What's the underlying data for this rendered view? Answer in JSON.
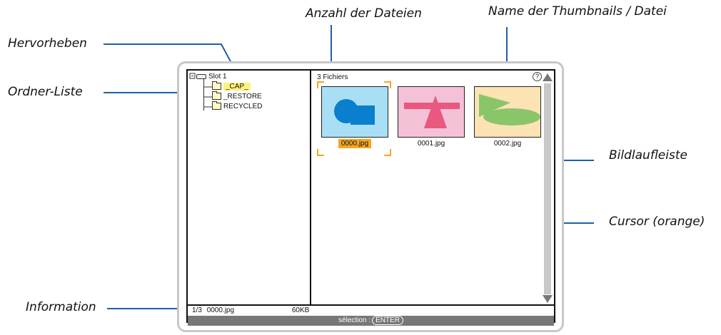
{
  "callouts": {
    "hervorheben": "Hervorheben",
    "ordner_liste": "Ordner-Liste",
    "anzahl": "Anzahl der Dateien",
    "name": "Name der Thumbnails / Datei",
    "bildlauf": "Bildlaufleiste",
    "cursor": "Cursor (orange)",
    "information": "Information"
  },
  "tree": {
    "root": "Slot 1",
    "folders": [
      "_CAP_",
      "_RESTORE",
      "RECYCLED"
    ],
    "highlight_color": "#fff27a"
  },
  "main": {
    "file_count": "3 Fichiers",
    "help_icon": "?",
    "thumbnails": [
      {
        "name": "0000.jpg",
        "bg": "#a9dff5",
        "selected": true
      },
      {
        "name": "0001.jpg",
        "bg": "#f5c1d6",
        "selected": false
      },
      {
        "name": "0002.jpg",
        "bg": "#fde2b3",
        "selected": false
      }
    ],
    "cursor_color": "#f5a623"
  },
  "info": {
    "index": "1/3",
    "filename": "0000.jpg",
    "size": "60KB"
  },
  "status": {
    "label": "sélection :",
    "key": "ENTER"
  }
}
